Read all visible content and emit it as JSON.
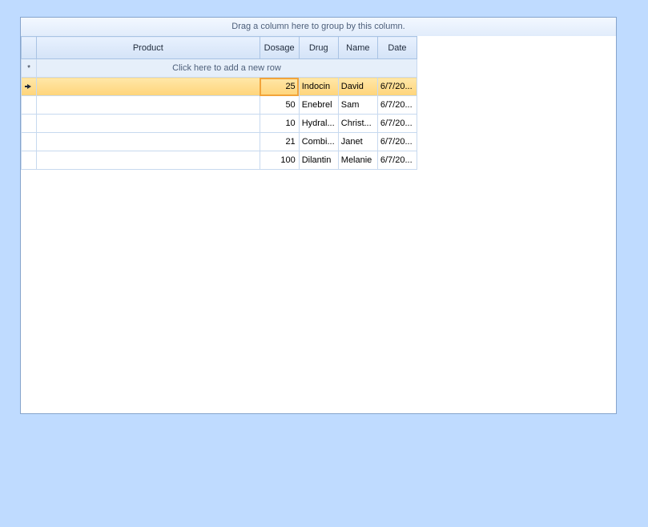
{
  "grid": {
    "group_panel_text": "Drag a column here to group by this column.",
    "columns": [
      "Product",
      "Dosage",
      "Drug",
      "Name",
      "Date"
    ],
    "new_row_text": "Click here to add a new row",
    "new_row_glyph": "*",
    "rows": [
      {
        "product": "",
        "dosage": "25",
        "drug": "Indocin",
        "name": "David",
        "date": "6/7/20..."
      },
      {
        "product": "",
        "dosage": "50",
        "drug": "Enebrel",
        "name": "Sam",
        "date": "6/7/20..."
      },
      {
        "product": "",
        "dosage": "10",
        "drug": "Hydral...",
        "name": "Christ...",
        "date": "6/7/20..."
      },
      {
        "product": "",
        "dosage": "21",
        "drug": "Combi...",
        "name": "Janet",
        "date": "6/7/20..."
      },
      {
        "product": "",
        "dosage": "100",
        "drug": "Dilantin",
        "name": "Melanie",
        "date": "6/7/20..."
      }
    ]
  },
  "colors": {
    "background": "#bfdbff",
    "selected_row": "#ffd47a",
    "current_cell_border": "#f2a43a",
    "grid_lines": "#c7d9ef"
  }
}
